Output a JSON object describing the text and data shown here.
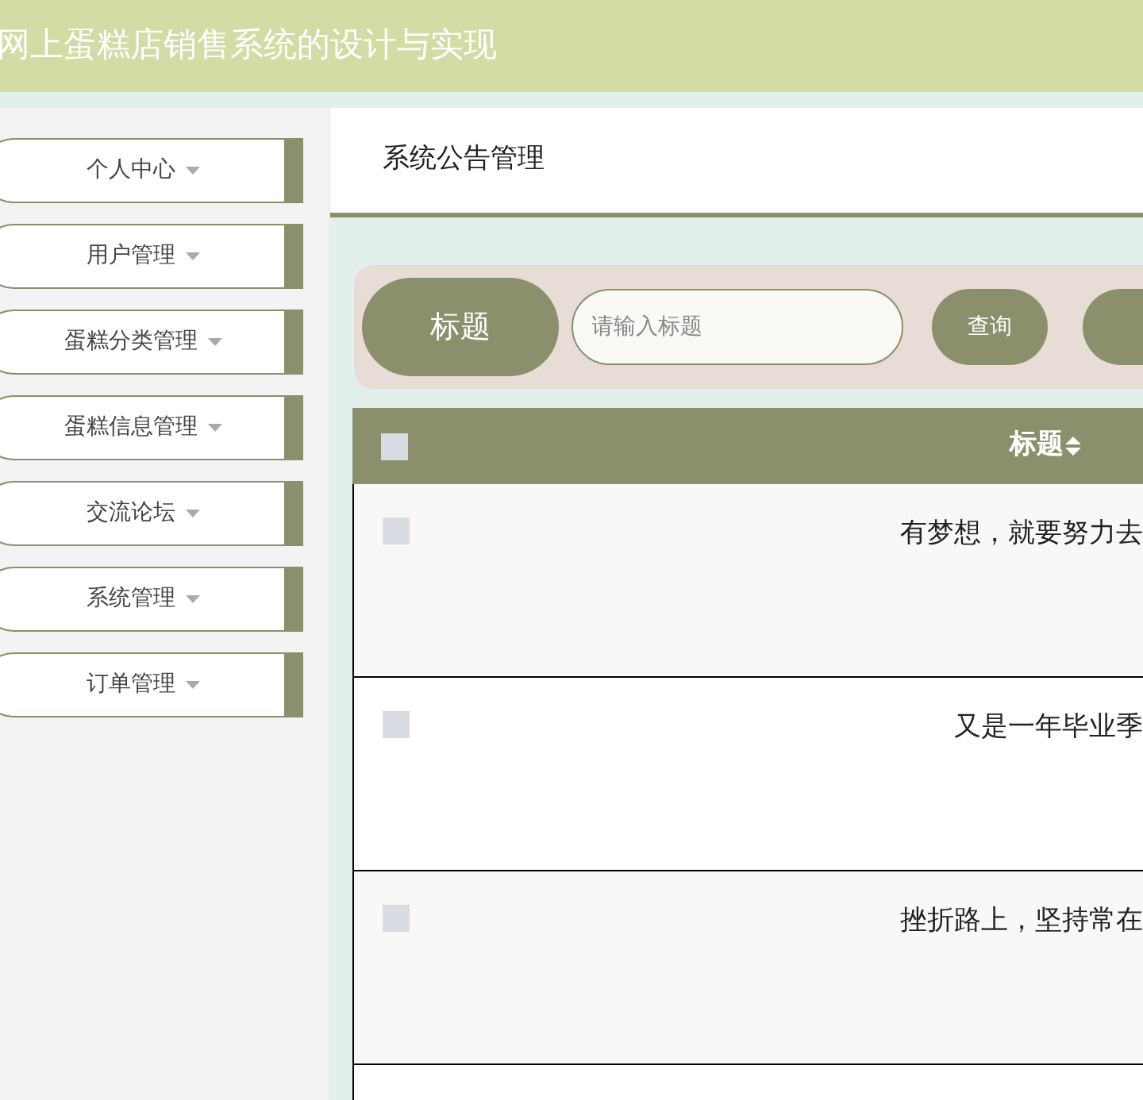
{
  "header": {
    "title": "网上蛋糕店销售系统的设计与实现"
  },
  "sidebar": {
    "items": [
      {
        "label": "个人中心",
        "expanded": false
      },
      {
        "label": "用户管理",
        "expanded": false
      },
      {
        "label": "蛋糕分类管理",
        "expanded": false
      },
      {
        "label": "蛋糕信息管理",
        "expanded": false
      },
      {
        "label": "交流论坛",
        "expanded": false
      },
      {
        "label": "系统管理",
        "expanded": false
      },
      {
        "label": "订单管理",
        "expanded": false
      }
    ]
  },
  "breadcrumb": "系统公告管理",
  "search": {
    "label": "标题",
    "placeholder": "请输入标题",
    "button": "查询"
  },
  "table": {
    "header_checked": false,
    "columns": [
      "标题"
    ],
    "rows": [
      {
        "checked": false,
        "title": "有梦想，就要努力去"
      },
      {
        "checked": false,
        "title": "又是一年毕业季"
      },
      {
        "checked": false,
        "title": "挫折路上，坚持常在"
      }
    ]
  }
}
